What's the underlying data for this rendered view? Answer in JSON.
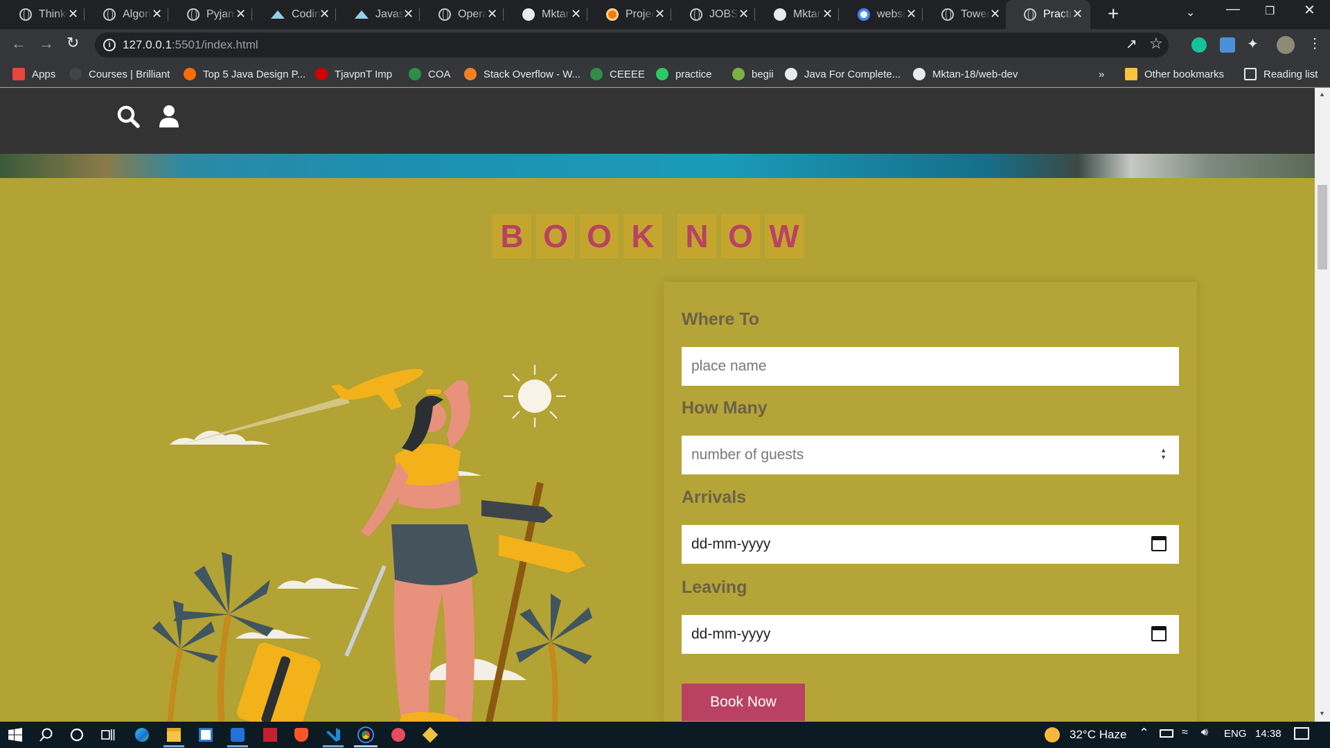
{
  "browser": {
    "tabs": [
      {
        "title": "Thinki",
        "icon": "globe"
      },
      {
        "title": "Algori",
        "icon": "globe"
      },
      {
        "title": "Pyjam",
        "icon": "globe"
      },
      {
        "title": "Codin",
        "icon": "mount"
      },
      {
        "title": "Javasc",
        "icon": "mount"
      },
      {
        "title": "Opera",
        "icon": "globe"
      },
      {
        "title": "Mktan",
        "icon": "gh"
      },
      {
        "title": "Projec",
        "icon": "orange"
      },
      {
        "title": "JOBSE",
        "icon": "globe"
      },
      {
        "title": "Mktan",
        "icon": "gh"
      },
      {
        "title": "websi",
        "icon": "goog"
      },
      {
        "title": "Tower",
        "icon": "globe"
      },
      {
        "title": "Practi",
        "icon": "globe",
        "active": true
      }
    ],
    "close_glyph": "✕",
    "new_tab_glyph": "+",
    "url_host": "127.0.0.1",
    "url_path": ":5501/index.html",
    "bookmarks": [
      {
        "label": "Apps",
        "color": "#e8453c"
      },
      {
        "label": "Courses | Brilliant",
        "color": "#444444"
      },
      {
        "label": "Top 5 Java Design P...",
        "color": "#ff6d00"
      },
      {
        "label": "TjavpnT Imp",
        "color": "#d50000"
      },
      {
        "label": "COA",
        "color": "#2f8d46"
      },
      {
        "label": "Stack Overflow - W...",
        "color": "#f48024"
      },
      {
        "label": "CEEEE",
        "color": "#2f8d46"
      },
      {
        "label": "practice",
        "color": "#2ec866"
      },
      {
        "label": "begii",
        "color": "#7cb342"
      },
      {
        "label": "Java For Complete...",
        "color": "#e8eaed"
      },
      {
        "label": "Mktan-18/web-dev",
        "color": "#e8eaed"
      }
    ],
    "bookmarks_more": "»",
    "other_bookmarks": "Other bookmarks",
    "reading_list": "Reading list"
  },
  "page": {
    "heading_letters": [
      "B",
      "O",
      "O",
      "K",
      "N",
      "O",
      "W"
    ],
    "form": {
      "where_label": "Where To",
      "where_placeholder": "place name",
      "guests_label": "How Many",
      "guests_placeholder": "number of guests",
      "arrivals_label": "Arrivals",
      "arrivals_value": "dd-mm-yyyy",
      "leaving_label": "Leaving",
      "leaving_value": "dd-mm-yyyy",
      "submit_label": "Book Now"
    },
    "colors": {
      "background": "#b3a234",
      "accent": "#b94262",
      "header": "#333333"
    }
  },
  "taskbar": {
    "weather": "32°C Haze",
    "language": "ENG",
    "time": "14:38"
  }
}
